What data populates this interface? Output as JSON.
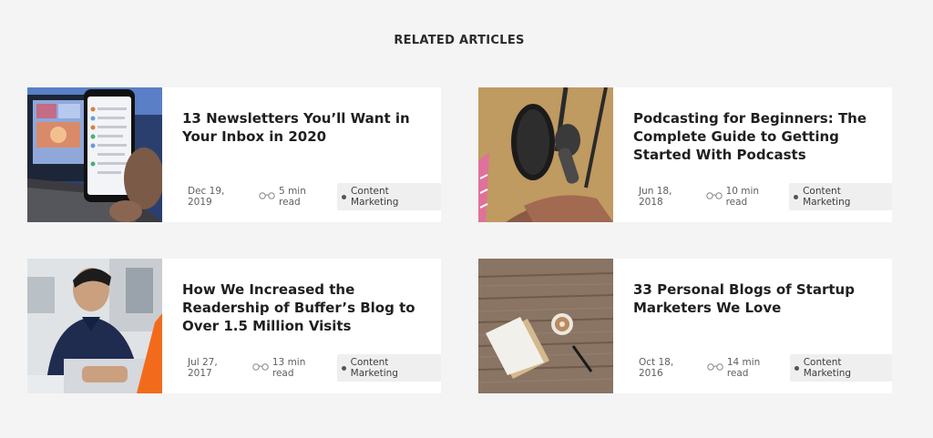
{
  "section_title": "RELATED ARTICLES",
  "articles": [
    {
      "title": "13 Newsletters You’ll Want in Your Inbox in 2020",
      "date": "Dec 19, 2019",
      "read_time": "5 min read",
      "category": "Content Marketing"
    },
    {
      "title": "Podcasting for Beginners: The Complete Guide to Getting Started With Podcasts",
      "date": "Jun 18, 2018",
      "read_time": "10 min read",
      "category": "Content Marketing"
    },
    {
      "title": "How We Increased the Readership of Buffer’s Blog to Over 1.5 Million Visits",
      "date": "Jul 27, 2017",
      "read_time": "13 min read",
      "category": "Content Marketing"
    },
    {
      "title": "33 Personal Blogs of Startup Marketers We Love",
      "date": "Oct 18, 2016",
      "read_time": "14 min read",
      "category": "Content Marketing"
    }
  ]
}
